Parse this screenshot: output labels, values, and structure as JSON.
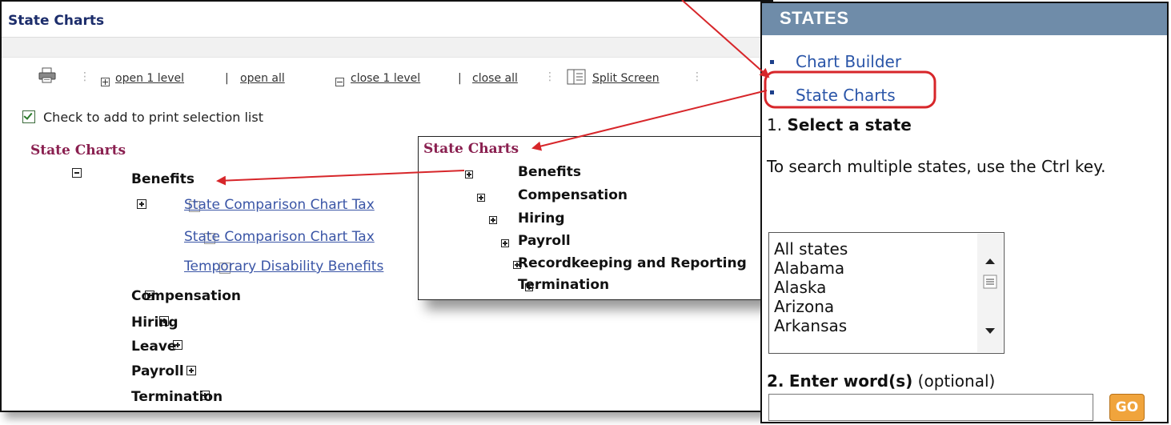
{
  "main": {
    "title": "State Charts",
    "toolbar": {
      "open_level": "open 1 level",
      "open_all": "open all",
      "close_level": "close 1 level",
      "close_all": "close all",
      "split_screen": "Split Screen",
      "sep": "|"
    },
    "check_label": "Check to add to print selection list",
    "tree": {
      "title": "State Charts",
      "benefits": "Benefits",
      "benefit_items": [
        "State Comparison Chart Tax",
        "State Comparison Chart Tax",
        "Temporary Disability Benefits"
      ],
      "nodes": [
        "Compensation",
        "Hiring",
        "Leave",
        "Payroll",
        "Termination"
      ]
    }
  },
  "popup": {
    "title": "State Charts",
    "nodes": [
      "Benefits",
      "Compensation",
      "Hiring",
      "Payroll",
      "Recordkeeping and Reporting",
      "Termination"
    ]
  },
  "states": {
    "header": "STATES",
    "links": [
      "Chart Builder",
      "State Charts"
    ],
    "step1_num": "1.",
    "step1": "Select a state",
    "hint": "To search multiple states, use the Ctrl key.",
    "options": [
      "All states",
      "Alabama",
      "Alaska",
      "Arizona",
      "Arkansas"
    ],
    "step2_num": "2.",
    "step2": "Enter word(s)",
    "step2_optional": "(optional)",
    "word_value": "",
    "go": "GO"
  },
  "colors": {
    "annotation": "#d7262a",
    "states_header": "#6f8ca9",
    "go_button": "#f0a43c",
    "tree_title": "#8a2050"
  }
}
